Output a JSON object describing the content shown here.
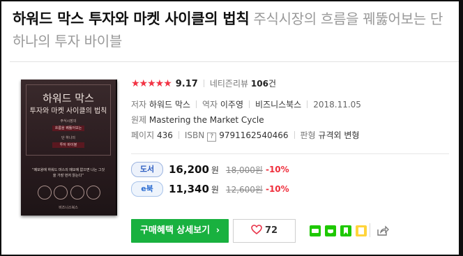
{
  "title": {
    "main": "하워드 막스 투자와 마켓 사이클의 법칙",
    "subtitle": "주식시장의 흐름을 꿰뚫어보는 단 하나의 투자 바이블"
  },
  "cover": {
    "title_line1": "하워드 막스",
    "title_line2": "투자와 마켓 사이클의 법칙",
    "bar1": "주식시장의",
    "bar2": "흐름을 꿰뚫어보는",
    "bar3": "단 하나의",
    "bar4": "투자 바이블",
    "quote": "“메모왕에 하워드 마스의 메모에 없으면 나는 그것을 가장 먼저 읽는다”",
    "publisher": "비즈니스북스"
  },
  "rating": {
    "stars": "★★★★★",
    "score": "9.17",
    "review_label": "네티즌리뷰",
    "review_count": "106",
    "review_unit": "건"
  },
  "meta": {
    "author_label": "저자",
    "author": "하워드 막스",
    "translator_label": "역자",
    "translator": "이주영",
    "publisher": "비즈니스북스",
    "date": "2018.11.05",
    "original_label": "원제",
    "original": "Mastering the Market Cycle",
    "pages_label": "페이지",
    "pages": "436",
    "isbn_label": "ISBN",
    "isbn_help": "?",
    "isbn": "9791162540466",
    "format_label": "판형",
    "format": "규격외 변형"
  },
  "prices": {
    "book": {
      "badge": "도서",
      "price": "16,200",
      "won": "원",
      "original": "18,000원",
      "discount": "-10%"
    },
    "ebook": {
      "badge": "e북",
      "price": "11,340",
      "won": "원",
      "original": "12,600원",
      "discount": "-10%"
    }
  },
  "actions": {
    "buy_label": "구매혜택 상세보기",
    "buy_arrow": "›",
    "like_count": "72"
  },
  "colors": {
    "accent_red": "#ef2e3c",
    "buy_green": "#19b13f",
    "badge_blue": "#2a5bc0"
  }
}
